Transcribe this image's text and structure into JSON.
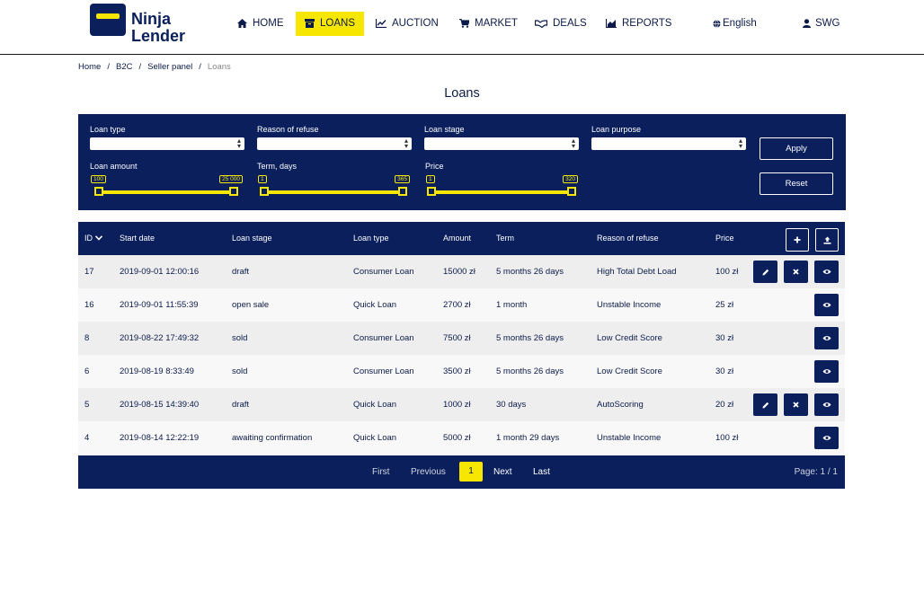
{
  "brand": {
    "line1": "Ninja",
    "line2": "Lender"
  },
  "nav": {
    "items": [
      {
        "label": "HOME",
        "icon": "home-icon"
      },
      {
        "label": "LOANS",
        "icon": "box-icon",
        "active": true
      },
      {
        "label": "AUCTION",
        "icon": "line-chart-icon"
      },
      {
        "label": "MARKET",
        "icon": "cart-icon"
      },
      {
        "label": "DEALS",
        "icon": "handshake-icon"
      },
      {
        "label": "REPORTS",
        "icon": "area-chart-icon"
      }
    ],
    "language": "English",
    "user": "SWG"
  },
  "breadcrumb": [
    "Home",
    "B2C",
    "Seller panel",
    "Loans"
  ],
  "page_title": "Loans",
  "filters": {
    "selects": [
      {
        "label": "Loan type",
        "value": ""
      },
      {
        "label": "Reason of refuse",
        "value": ""
      },
      {
        "label": "Loan stage",
        "value": ""
      },
      {
        "label": "Loan purpose",
        "value": ""
      }
    ],
    "sliders": [
      {
        "label": "Loan amount",
        "min": "100",
        "max": "25 000"
      },
      {
        "label": "Term, days",
        "min": "1",
        "max": "365"
      },
      {
        "label": "Price",
        "min": "1",
        "max": "320"
      }
    ],
    "apply_label": "Apply",
    "reset_label": "Reset"
  },
  "table": {
    "headers": [
      "ID",
      "Start date",
      "Loan stage",
      "Loan type",
      "Amount",
      "Term",
      "Reason of refuse",
      "Price"
    ],
    "rows": [
      {
        "id": "17",
        "start": "2019-09-01 12:00:16",
        "stage": "draft",
        "type": "Consumer Loan",
        "amount": "15000 zł",
        "term": "5 months 26 days",
        "reason": "High Total Debt Load",
        "price": "100 zł",
        "editable": true
      },
      {
        "id": "16",
        "start": "2019-09-01 11:55:39",
        "stage": "open sale",
        "type": "Quick Loan",
        "amount": "2700 zł",
        "term": "1 month",
        "reason": "Unstable Income",
        "price": "25 zł",
        "editable": false
      },
      {
        "id": "8",
        "start": "2019-08-22 17:49:32",
        "stage": "sold",
        "type": "Consumer Loan",
        "amount": "7500 zł",
        "term": "5 months 26 days",
        "reason": "Low Credit Score",
        "price": "30 zł",
        "editable": false
      },
      {
        "id": "6",
        "start": "2019-08-19 8:33:49",
        "stage": "sold",
        "type": "Consumer Loan",
        "amount": "3500 zł",
        "term": "5 months 26 days",
        "reason": "Low Credit Score",
        "price": "30 zł",
        "editable": false
      },
      {
        "id": "5",
        "start": "2019-08-15 14:39:40",
        "stage": "draft",
        "type": "Quick Loan",
        "amount": "1000 zł",
        "term": "30 days",
        "reason": "AutoScoring",
        "price": "20 zł",
        "editable": true
      },
      {
        "id": "4",
        "start": "2019-08-14 12:22:19",
        "stage": "awaiting confirmation",
        "type": "Quick Loan",
        "amount": "5000 zł",
        "term": "1 month 29 days",
        "reason": "Unstable Income",
        "price": "100 zł",
        "editable": false
      }
    ]
  },
  "pagination": {
    "first": "First",
    "previous": "Previous",
    "current": "1",
    "next": "Next",
    "last": "Last",
    "info": "Page: 1 / 1"
  },
  "colors": {
    "navy": "#0a1f5c",
    "accent": "#f7e600"
  }
}
